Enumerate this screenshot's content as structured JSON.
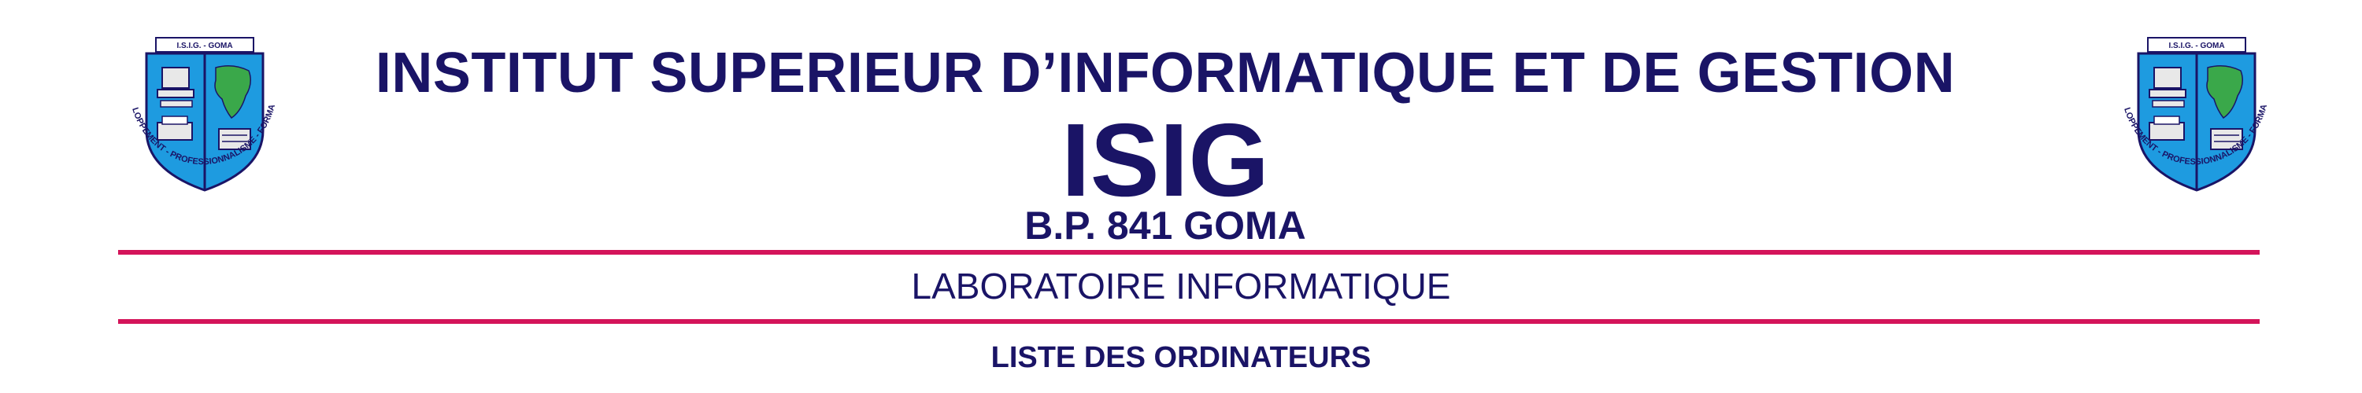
{
  "header": {
    "institution_name": "INSTITUT SUPERIEUR D’INFORMATIQUE ET DE GESTION",
    "acronym": "ISIG",
    "postal_address": "B.P. 841 GOMA"
  },
  "logo": {
    "top_text": "I.S.I.G. - GOMA",
    "motto": "DEVELOPPEMENT - PROFESSIONNALISME - FORMATION",
    "icon": "shield-crest-icon"
  },
  "section": {
    "department": "LABORATOIRE INFORMATIQUE",
    "document_title": "LISTE DES ORDINATEURS"
  },
  "colors": {
    "text": "#1a1466",
    "rule": "#d4145a",
    "shield_blue": "#1e9be0",
    "shield_green": "#2e8b3e"
  }
}
